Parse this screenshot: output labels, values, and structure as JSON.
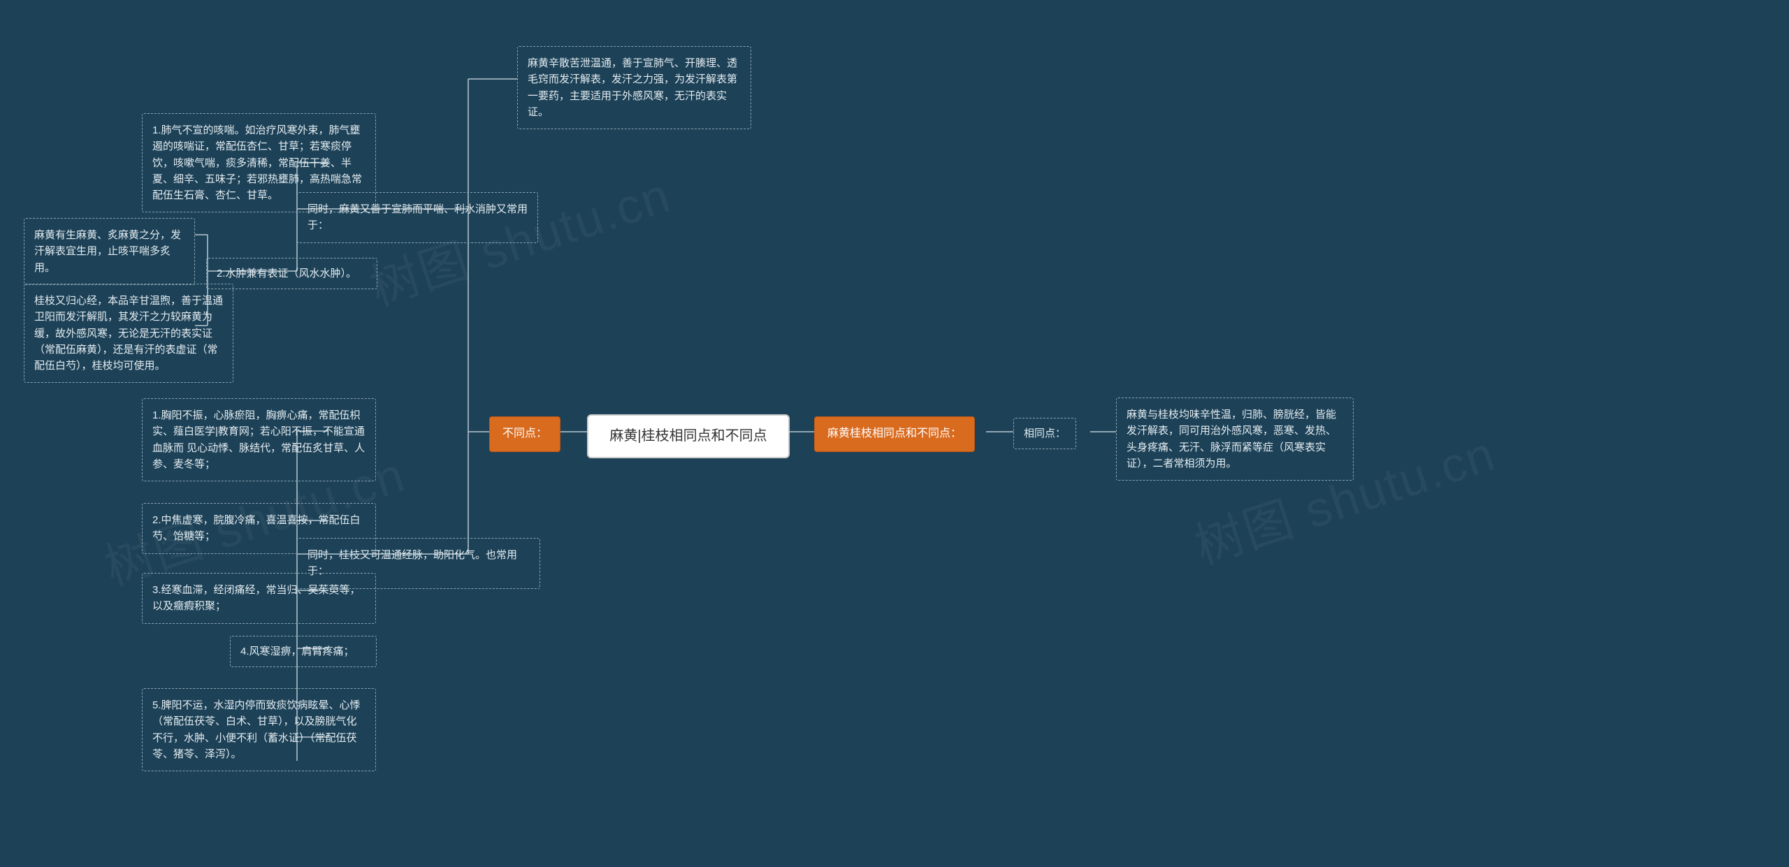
{
  "root": {
    "title": "麻黄|桂枝相同点和不同点"
  },
  "right": {
    "l1": {
      "label": "麻黄桂枝相同点和不同点："
    },
    "l2": {
      "label": "相同点："
    },
    "l3": {
      "text": "麻黄与桂枝均味辛性温，归肺、膀胱经，皆能发汗解表，同可用治外感风寒，恶寒、发热、头身疼痛、无汗、脉浮而紧等症（风寒表实证），二者常相须为用。"
    }
  },
  "left": {
    "l1": {
      "label": "不同点："
    },
    "b1": {
      "text": "麻黄辛散苦泄温通，善于宣肺气、开腠理、透毛窍而发汗解表，发汗之力强，为发汗解表第一要药，主要适用于外感风寒，无汗的表实证。"
    },
    "b2": {
      "text": "同时，麻黄又善于宣肺而平喘、利水消肿又常用于："
    },
    "b2c1": {
      "text": "1.肺气不宣的咳喘。如治疗风寒外束，肺气壅遏的咳喘证，常配伍杏仁、甘草；若寒痰停饮，咳嗽气喘，痰多清稀，常配伍干姜、半夏、细辛、五味子；若邪热壅肺，高热喘急常配伍生石膏、杏仁、甘草。"
    },
    "b2c2": {
      "text": "2.水肿兼有表证（风水水肿）。"
    },
    "b2c2a": {
      "text": "麻黄有生麻黄、炙麻黄之分，发汗解表宜生用，止咳平喘多炙用。"
    },
    "b2c2b": {
      "text": "桂枝又归心经，本品辛甘温煦，善于温通卫阳而发汗解肌，其发汗之力较麻黄为缓，故外感风寒，无论是无汗的表实证（常配伍麻黄），还是有汗的表虚证（常配伍白芍），桂枝均可使用。"
    },
    "b3": {
      "text": "同时，桂枝又可温通经脉，助阳化气。也常用于："
    },
    "b3c1": {
      "text": "1.胸阳不振，心脉瘀阻，胸痹心痛，常配伍枳实、薤白医学|教育网；若心阳不振，不能宣通血脉而 见心动悸、脉结代，常配伍炙甘草、人参、麦冬等；"
    },
    "b3c2": {
      "text": "2.中焦虚寒，脘腹冷痛，喜温喜按，常配伍白芍、饴糖等；"
    },
    "b3c3": {
      "text": "3.经寒血滞，经闭痛经，常当归、吴茱萸等，以及癥瘕积聚；"
    },
    "b3c4": {
      "text": "4.风寒湿痹，肩臂疼痛；"
    },
    "b3c5": {
      "text": "5.脾阳不运，水湿内停而致痰饮病眩晕、心悸（常配伍茯苓、白术、甘草），以及膀胱气化不行，水肿、小便不利（蓄水证）（常配伍茯苓、猪苓、泽泻）。"
    }
  },
  "watermark": "树图 shutu.cn"
}
